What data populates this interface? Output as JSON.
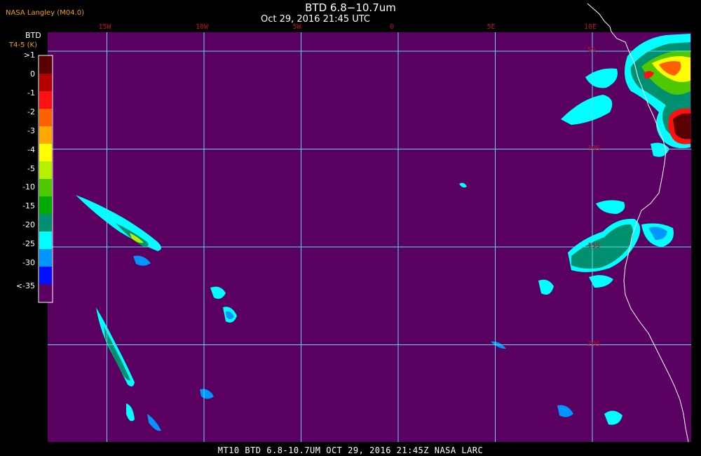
{
  "header": {
    "title": "BTD 6.8−10.7um",
    "date": "Oct 29, 2016 21:45 UTC",
    "agency": "NASA Langley (M04.0)"
  },
  "footer": {
    "text": "MT10   BTD 6.8-10.7UM   OCT 29, 2016 21:45Z   NASA LARC"
  },
  "legend": {
    "title1": "BTD",
    "title2": "T4-5 (K)",
    "labels": [
      ">1",
      "0",
      "-1",
      "-2",
      "-3",
      "-4",
      "-5",
      "-10",
      "-15",
      "-20",
      "-25",
      "-30",
      "<-35"
    ],
    "colors": [
      "#5a0000",
      "#b40000",
      "#ff1010",
      "#ff6000",
      "#ffa800",
      "#ffff00",
      "#b4f000",
      "#4ec800",
      "#00aa00",
      "#009070",
      "#00ffff",
      "#0096ff",
      "#0010ff",
      "#5a0060"
    ]
  },
  "map": {
    "background_color": "#5a0060",
    "grid_color": "#5fd8f0",
    "coast_color": "#ffffff",
    "longitudes": [
      {
        "label": "15W",
        "value": -15
      },
      {
        "label": "10W",
        "value": -10
      },
      {
        "label": "5W",
        "value": -5
      },
      {
        "label": "0",
        "value": 0
      },
      {
        "label": "5E",
        "value": 5
      },
      {
        "label": "10E",
        "value": 10
      }
    ],
    "latitudes": [
      {
        "label": "5S",
        "value": -5
      },
      {
        "label": "10S",
        "value": -10
      },
      {
        "label": "15S",
        "value": -15
      },
      {
        "label": "20S",
        "value": -20
      }
    ]
  }
}
